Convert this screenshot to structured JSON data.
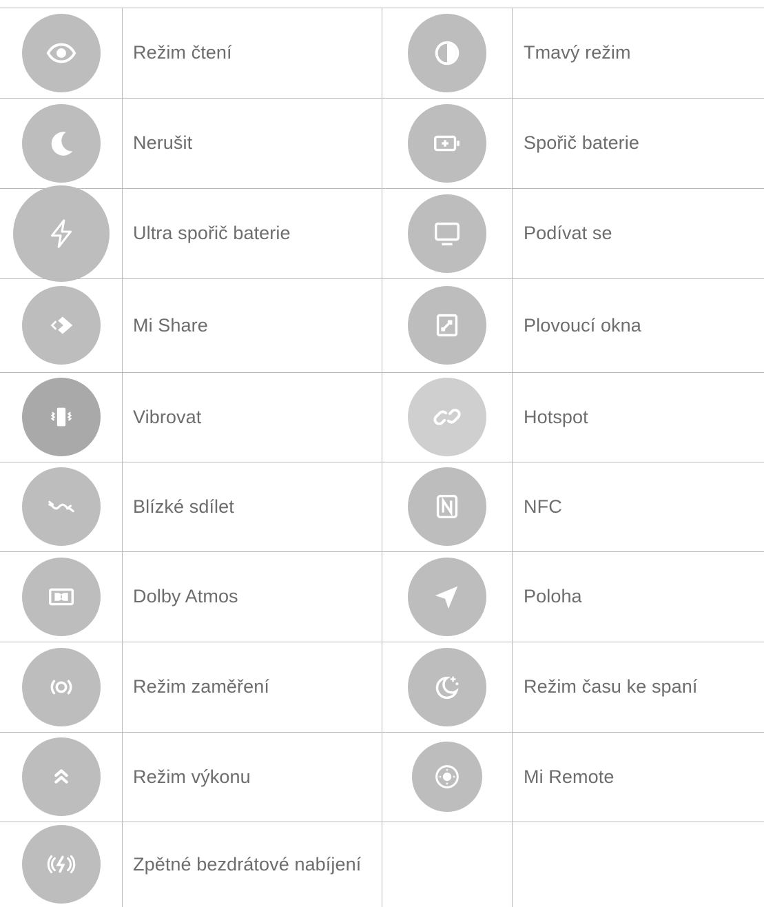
{
  "rows": [
    {
      "left": {
        "label": "Režim čtení",
        "icon": "eye-icon"
      },
      "right": {
        "label": "Tmavý režim",
        "icon": "half-circle-icon"
      }
    },
    {
      "left": {
        "label": "Nerušit",
        "icon": "moon-icon"
      },
      "right": {
        "label": "Spořič baterie",
        "icon": "battery-plus-icon"
      }
    },
    {
      "left": {
        "label": "Ultra spořič baterie",
        "icon": "lightning-icon"
      },
      "right": {
        "label": "Podívat se",
        "icon": "monitor-icon"
      }
    },
    {
      "left": {
        "label": "Mi Share",
        "icon": "mi-share-icon"
      },
      "right": {
        "label": "Plovoucí okna",
        "icon": "floating-window-icon"
      }
    },
    {
      "left": {
        "label": "Vibrovat",
        "icon": "vibrate-icon"
      },
      "right": {
        "label": "Hotspot",
        "icon": "link-icon"
      }
    },
    {
      "left": {
        "label": "Blízké sdílet",
        "icon": "nearby-share-icon"
      },
      "right": {
        "label": "NFC",
        "icon": "nfc-icon"
      }
    },
    {
      "left": {
        "label": "Dolby Atmos",
        "icon": "dolby-icon"
      },
      "right": {
        "label": "Poloha",
        "icon": "location-arrow-icon"
      }
    },
    {
      "left": {
        "label": "Režim zaměření",
        "icon": "focus-icon"
      },
      "right": {
        "label": "Režim času ke spaní",
        "icon": "bedtime-icon"
      }
    },
    {
      "left": {
        "label": "Režim výkonu",
        "icon": "performance-chevrons-icon"
      },
      "right": {
        "label": "Mi Remote",
        "icon": "remote-icon"
      }
    },
    {
      "left": {
        "label": "Zpětné bezdrátové nabíjení",
        "icon": "reverse-charging-icon"
      },
      "right": {
        "label": "",
        "icon": ""
      }
    }
  ],
  "colors": {
    "circle": "#bdbdbd",
    "glyph": "#ffffff",
    "text": "#6d6d6d",
    "grid": "#b9b9b9"
  }
}
